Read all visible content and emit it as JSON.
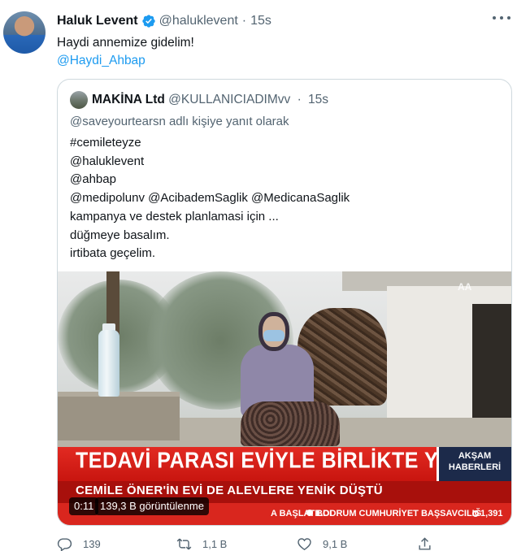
{
  "author": {
    "name": "Haluk Levent",
    "handle": "@haluklevent",
    "separator": "·",
    "time": "15s"
  },
  "tweet": {
    "text": "Haydi annemize gidelim!",
    "mention": "@Haydi_Ahbap"
  },
  "quote": {
    "name": "MAKİNA Ltd",
    "handle": "@KULLANICIADIMvv",
    "separator": "·",
    "time": "15s",
    "reply_context": "@saveyourtearsn adlı kişiye yanıt olarak",
    "lines": [
      "#cemileteyze",
      "@haluklevent",
      "@ahbap",
      "@medipolunv @AcibademSaglik @MedicanaSaglik",
      "kampanya ve destek planlamasi için ...",
      "düğmeye basalım.",
      "irtibata geçelim."
    ],
    "video": {
      "headline": "TEDAVİ PARASI EVİYLE BİRLİKTE YANDI",
      "subheadline": "CEMİLE ÖNER'İN EVİ DE ALEVLERE YENİK DÜŞTÜ",
      "show_badge_line1": "AKŞAM",
      "show_badge_line2": "HABERLERİ",
      "ticker_a": "A BAŞLATILDI",
      "ticker_b": "BODRUM CUMHURİYET BAŞSAVCILIĞ",
      "ticker_c": "1,391",
      "logo": "AA",
      "duration": "0:11",
      "views": "139,3 B görüntülenme"
    }
  },
  "actions": {
    "reply_count": "139",
    "retweet_count": "1,1 B",
    "like_count": "9,1 B"
  },
  "colors": {
    "accent": "#1d9bf0",
    "secondary_text": "#536471",
    "border": "#cfd9de"
  }
}
